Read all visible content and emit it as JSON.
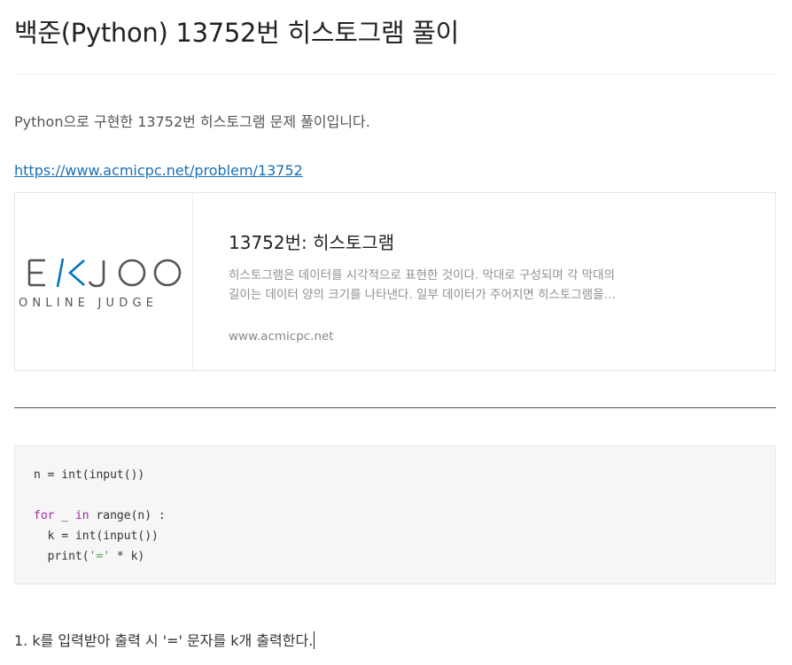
{
  "post": {
    "title": "백준(Python) 13752번 히스토그램 풀이",
    "intro": "Python으로 구현한 13752번 히스토그램 문제 풀이입니다.",
    "link": "https://www.acmicpc.net/problem/13752"
  },
  "link_card": {
    "logo_text_top": "BAEKJOON",
    "logo_text_bottom": "ONLINE JUDGE",
    "title": "13752번: 히스토그램",
    "description": "히스토그램은 데이터를 시각적으로 표현한 것이다. 막대로 구성되며 각 막대의 길이는 데이터 양의 크기를 나타낸다. 일부 데이터가 주어지면 히스토그램을 생성하시오.",
    "url": "www.acmicpc.net",
    "colors": {
      "logo_gray": "#555555",
      "logo_blue": "#0076c0"
    }
  },
  "code": {
    "line1": "n = int(input())",
    "line3_kw_for": "for",
    "line3_mid": " _ ",
    "line3_kw_in": "in",
    "line3_rest": " range(n) :",
    "line4": "  k = int(input())",
    "line5_a": "  print(",
    "line5_str": "'='",
    "line5_b": " * k)"
  },
  "explanation": "1. k를 입력받아 출력 시 '=' 문자를 k개 출력한다.",
  "colors": {
    "link": "#1a6fb5",
    "keyword": "#a626a4",
    "code_bg": "#f6f6f6"
  }
}
